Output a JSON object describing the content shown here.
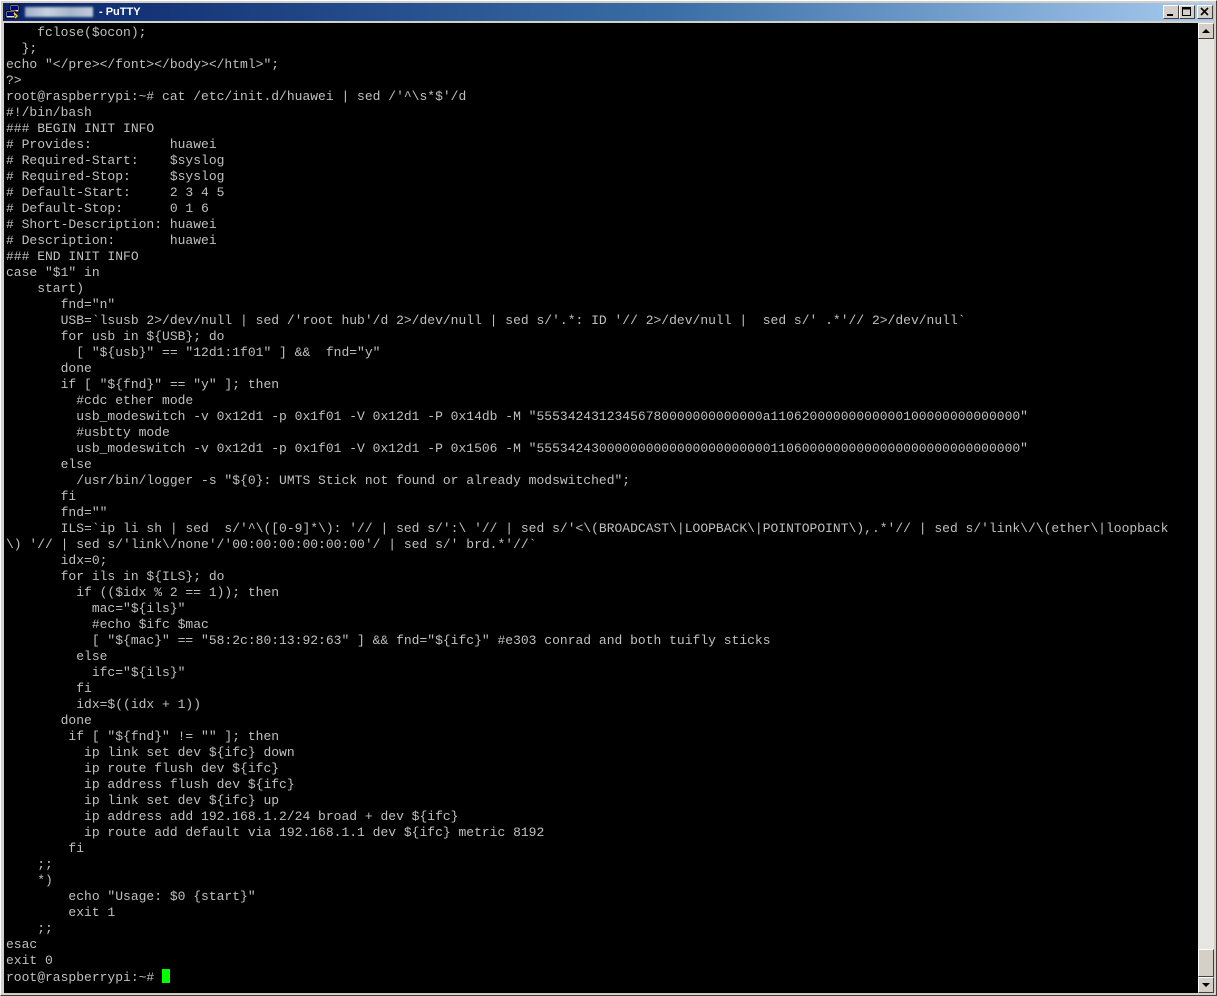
{
  "window": {
    "title": "- PuTTY"
  },
  "colors": {
    "terminal_background": "#000000",
    "terminal_text": "#c0c0c0",
    "cursor": "#00ff00",
    "titlebar_start": "#0a246a",
    "titlebar_end": "#a6caf0"
  },
  "icons": {
    "app": "putty-icon",
    "minimize": "minimize-icon",
    "maximize": "maximize-icon",
    "close": "close-icon"
  },
  "terminal": {
    "lines": [
      "    fclose($ocon);",
      "  };",
      "echo \"</pre></font></body></html>\";",
      "?>",
      "root@raspberrypi:~# cat /etc/init.d/huawei | sed /'^\\s*$'/d",
      "#!/bin/bash",
      "### BEGIN INIT INFO",
      "# Provides:          huawei",
      "# Required-Start:    $syslog",
      "# Required-Stop:     $syslog",
      "# Default-Start:     2 3 4 5",
      "# Default-Stop:      0 1 6",
      "# Short-Description: huawei",
      "# Description:       huawei",
      "### END INIT INFO",
      "case \"$1\" in",
      "    start)",
      "       fnd=\"n\"",
      "       USB=`lsusb 2>/dev/null | sed /'root hub'/d 2>/dev/null | sed s/'.*: ID '// 2>/dev/null |  sed s/' .*'// 2>/dev/null`",
      "       for usb in ${USB}; do",
      "         [ \"${usb}\" == \"12d1:1f01\" ] &&  fnd=\"y\"",
      "       done",
      "       if [ \"${fnd}\" == \"y\" ]; then",
      "         #cdc ether mode",
      "         usb_modeswitch -v 0x12d1 -p 0x1f01 -V 0x12d1 -P 0x14db -M \"55534243123456780000000000000a11062000000000000100000000000000\"",
      "         #usbtty mode",
      "         usb_modeswitch -v 0x12d1 -p 0x1f01 -V 0x12d1 -P 0x1506 -M \"55534243000000000000000000000011060000000000000000000000000000\"",
      "       else",
      "         /usr/bin/logger -s \"${0}: UMTS Stick not found or already modswitched\";",
      "       fi",
      "       fnd=\"\"",
      "       ILS=`ip li sh | sed  s/'^\\([0-9]*\\): '// | sed s/':\\ '// | sed s/'<\\(BROADCAST\\|LOOPBACK\\|POINTOPOINT\\),.*'// | sed s/'link\\/\\(ether\\|loopback",
      "\\) '// | sed s/'link\\/none'/'00:00:00:00:00:00'/ | sed s/' brd.*'//`",
      "       idx=0;",
      "       for ils in ${ILS}; do",
      "         if (($idx % 2 == 1)); then",
      "           mac=\"${ils}\"",
      "           #echo $ifc $mac",
      "           [ \"${mac}\" == \"58:2c:80:13:92:63\" ] && fnd=\"${ifc}\" #e303 conrad and both tuifly sticks",
      "         else",
      "           ifc=\"${ils}\"",
      "         fi",
      "         idx=$((idx + 1))",
      "       done",
      "        if [ \"${fnd}\" != \"\" ]; then",
      "          ip link set dev ${ifc} down",
      "          ip route flush dev ${ifc}",
      "          ip address flush dev ${ifc}",
      "          ip link set dev ${ifc} up",
      "          ip address add 192.168.1.2/24 broad + dev ${ifc}",
      "          ip route add default via 192.168.1.1 dev ${ifc} metric 8192",
      "        fi",
      "    ;;",
      "    *)",
      "        echo \"Usage: $0 {start}\"",
      "        exit 1",
      "    ;;",
      "esac",
      "exit 0"
    ],
    "prompt": "root@raspberrypi:~# "
  }
}
